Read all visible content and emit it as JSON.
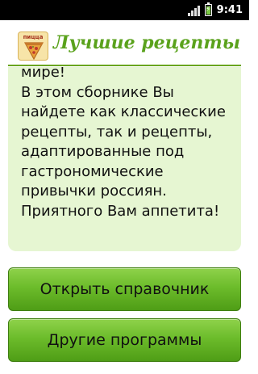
{
  "status_bar": {
    "time": "9:41",
    "icons": [
      "signal-icon",
      "battery-charging-icon"
    ],
    "battery_level": 0.8,
    "signal_bars": 4
  },
  "header": {
    "logo_label": "пицца",
    "title": "Лучшие рецепты"
  },
  "description": {
    "text": "мире!\nВ этом сборнике Вы найдете как классические рецепты, так и рецепты, адаптированные под гастрономические привычки россиян.\nПриятного Вам аппетита!"
  },
  "buttons": {
    "open_label": "Открыть справочник",
    "other_label": "Другие программы"
  },
  "colors": {
    "accent": "#6aa51f",
    "title": "#5aa21c",
    "panel_bg": "#e6f6d2",
    "button_top": "#8fd24b",
    "button_bottom": "#4f9d16"
  }
}
